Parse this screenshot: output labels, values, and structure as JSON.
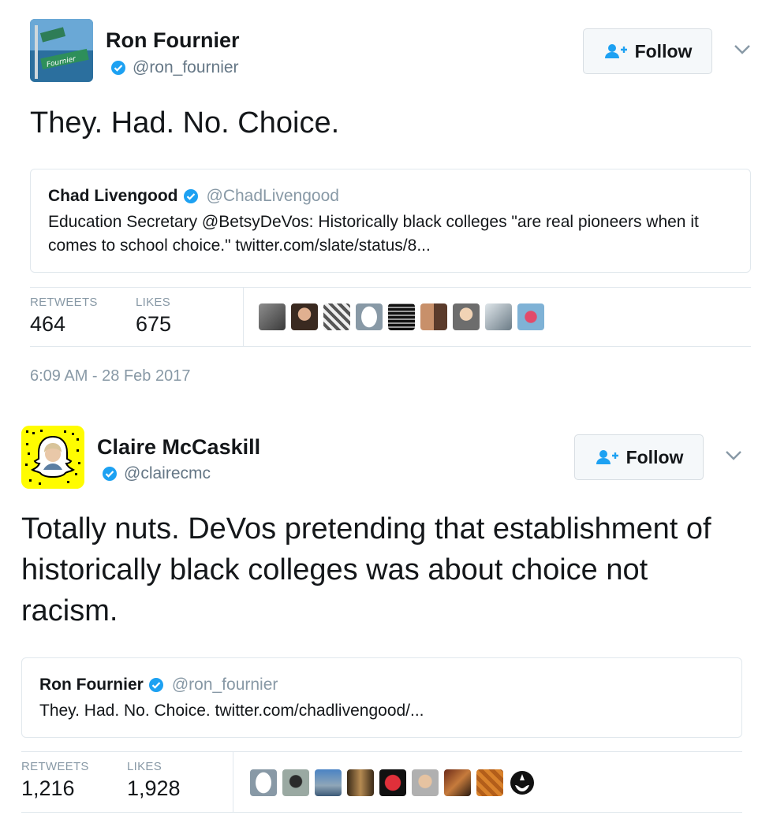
{
  "tweets": [
    {
      "name": "Ron Fournier",
      "handle": "@ron_fournier",
      "follow_label": "Follow",
      "text": "They. Had. No. Choice.",
      "quote": {
        "name": "Chad Livengood",
        "handle": "@ChadLivengood",
        "text": "Education Secretary @BetsyDeVos: Historically black colleges \"are real pioneers when it comes to school choice.\" twitter.com/slate/status/8..."
      },
      "retweets_label": "RETWEETS",
      "retweets": "464",
      "likes_label": "LIKES",
      "likes": "675",
      "timestamp": "6:09 AM - 28 Feb 2017"
    },
    {
      "name": "Claire McCaskill",
      "handle": "@clairecmc",
      "follow_label": "Follow",
      "text": "Totally nuts. DeVos pretending that establishment of historically black colleges was about choice not racism.",
      "quote": {
        "name": "Ron Fournier",
        "handle": "@ron_fournier",
        "text": "They. Had. No. Choice. twitter.com/chadlivengood/..."
      },
      "retweets_label": "RETWEETS",
      "retweets": "1,216",
      "likes_label": "LIKES",
      "likes": "1,928"
    }
  ],
  "colors": {
    "verified": "#1da1f2",
    "text": "#14171a",
    "muted": "#657786",
    "snapchat_yellow": "#fffc00"
  },
  "icons": [
    "verified-badge-icon",
    "follow-person-plus-icon",
    "chevron-down-icon"
  ]
}
